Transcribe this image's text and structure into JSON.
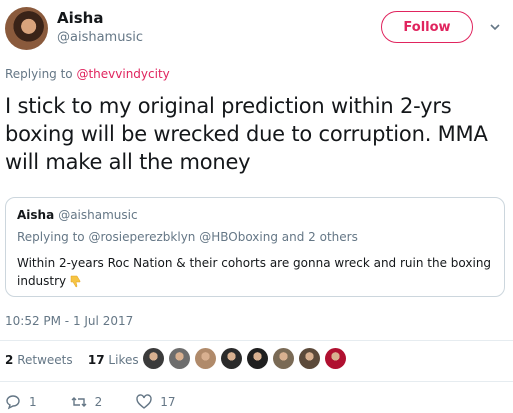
{
  "author": {
    "name": "Aisha",
    "handle": "@aishamusic"
  },
  "follow_label": "Follow",
  "replying": {
    "prefix": "Replying to ",
    "mention": "@thevvindycity"
  },
  "tweet_text": "I stick to my original prediction within 2-yrs boxing will be wrecked due to corruption. MMA will make all the money",
  "quoted": {
    "name": "Aisha",
    "handle": "@aishamusic",
    "replying": "Replying to @rosieperezbklyn @HBOboxing and 2 others",
    "text": "Within 2-years Roc Nation & their cohorts are gonna wreck and ruin the boxing industry"
  },
  "timestamp": "10:52 PM - 1 Jul 2017",
  "stats": {
    "retweets_count": "2",
    "retweets_label": "Retweets",
    "likes_count": "17",
    "likes_label": "Likes"
  },
  "likers": [
    "#3b3b3b",
    "#6d6d6d",
    "#b08a6a",
    "#2a2a2a",
    "#1f1f1f",
    "#7a6a55",
    "#5c4a3a",
    "#b01030"
  ],
  "actions": {
    "replies": "1",
    "retweets": "2",
    "likes": "17"
  },
  "colors": {
    "accent": "#e0245e",
    "muted": "#657786"
  }
}
